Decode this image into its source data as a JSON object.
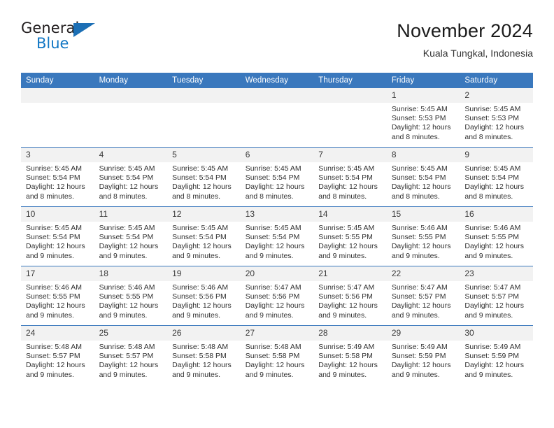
{
  "brand": {
    "name_part1": "General",
    "name_part2": "Blue",
    "logo_icon": "triangle-logo-icon"
  },
  "header": {
    "month_title": "November 2024",
    "location": "Kuala Tungkal, Indonesia"
  },
  "calendar": {
    "weekday_headers": [
      "Sunday",
      "Monday",
      "Tuesday",
      "Wednesday",
      "Thursday",
      "Friday",
      "Saturday"
    ],
    "colors": {
      "header_blue": "#3a78bd",
      "daynum_band": "#f2f2f2",
      "brand_blue": "#1277c4",
      "text": "#303030"
    },
    "weeks": [
      [
        {
          "day": "",
          "sunrise": "",
          "sunset": "",
          "daylight": "",
          "empty": true
        },
        {
          "day": "",
          "sunrise": "",
          "sunset": "",
          "daylight": "",
          "empty": true
        },
        {
          "day": "",
          "sunrise": "",
          "sunset": "",
          "daylight": "",
          "empty": true
        },
        {
          "day": "",
          "sunrise": "",
          "sunset": "",
          "daylight": "",
          "empty": true
        },
        {
          "day": "",
          "sunrise": "",
          "sunset": "",
          "daylight": "",
          "empty": true
        },
        {
          "day": "1",
          "sunrise": "Sunrise: 5:45 AM",
          "sunset": "Sunset: 5:53 PM",
          "daylight": "Daylight: 12 hours and 8 minutes.",
          "empty": false
        },
        {
          "day": "2",
          "sunrise": "Sunrise: 5:45 AM",
          "sunset": "Sunset: 5:53 PM",
          "daylight": "Daylight: 12 hours and 8 minutes.",
          "empty": false
        }
      ],
      [
        {
          "day": "3",
          "sunrise": "Sunrise: 5:45 AM",
          "sunset": "Sunset: 5:54 PM",
          "daylight": "Daylight: 12 hours and 8 minutes.",
          "empty": false
        },
        {
          "day": "4",
          "sunrise": "Sunrise: 5:45 AM",
          "sunset": "Sunset: 5:54 PM",
          "daylight": "Daylight: 12 hours and 8 minutes.",
          "empty": false
        },
        {
          "day": "5",
          "sunrise": "Sunrise: 5:45 AM",
          "sunset": "Sunset: 5:54 PM",
          "daylight": "Daylight: 12 hours and 8 minutes.",
          "empty": false
        },
        {
          "day": "6",
          "sunrise": "Sunrise: 5:45 AM",
          "sunset": "Sunset: 5:54 PM",
          "daylight": "Daylight: 12 hours and 8 minutes.",
          "empty": false
        },
        {
          "day": "7",
          "sunrise": "Sunrise: 5:45 AM",
          "sunset": "Sunset: 5:54 PM",
          "daylight": "Daylight: 12 hours and 8 minutes.",
          "empty": false
        },
        {
          "day": "8",
          "sunrise": "Sunrise: 5:45 AM",
          "sunset": "Sunset: 5:54 PM",
          "daylight": "Daylight: 12 hours and 8 minutes.",
          "empty": false
        },
        {
          "day": "9",
          "sunrise": "Sunrise: 5:45 AM",
          "sunset": "Sunset: 5:54 PM",
          "daylight": "Daylight: 12 hours and 8 minutes.",
          "empty": false
        }
      ],
      [
        {
          "day": "10",
          "sunrise": "Sunrise: 5:45 AM",
          "sunset": "Sunset: 5:54 PM",
          "daylight": "Daylight: 12 hours and 9 minutes.",
          "empty": false
        },
        {
          "day": "11",
          "sunrise": "Sunrise: 5:45 AM",
          "sunset": "Sunset: 5:54 PM",
          "daylight": "Daylight: 12 hours and 9 minutes.",
          "empty": false
        },
        {
          "day": "12",
          "sunrise": "Sunrise: 5:45 AM",
          "sunset": "Sunset: 5:54 PM",
          "daylight": "Daylight: 12 hours and 9 minutes.",
          "empty": false
        },
        {
          "day": "13",
          "sunrise": "Sunrise: 5:45 AM",
          "sunset": "Sunset: 5:54 PM",
          "daylight": "Daylight: 12 hours and 9 minutes.",
          "empty": false
        },
        {
          "day": "14",
          "sunrise": "Sunrise: 5:45 AM",
          "sunset": "Sunset: 5:55 PM",
          "daylight": "Daylight: 12 hours and 9 minutes.",
          "empty": false
        },
        {
          "day": "15",
          "sunrise": "Sunrise: 5:46 AM",
          "sunset": "Sunset: 5:55 PM",
          "daylight": "Daylight: 12 hours and 9 minutes.",
          "empty": false
        },
        {
          "day": "16",
          "sunrise": "Sunrise: 5:46 AM",
          "sunset": "Sunset: 5:55 PM",
          "daylight": "Daylight: 12 hours and 9 minutes.",
          "empty": false
        }
      ],
      [
        {
          "day": "17",
          "sunrise": "Sunrise: 5:46 AM",
          "sunset": "Sunset: 5:55 PM",
          "daylight": "Daylight: 12 hours and 9 minutes.",
          "empty": false
        },
        {
          "day": "18",
          "sunrise": "Sunrise: 5:46 AM",
          "sunset": "Sunset: 5:55 PM",
          "daylight": "Daylight: 12 hours and 9 minutes.",
          "empty": false
        },
        {
          "day": "19",
          "sunrise": "Sunrise: 5:46 AM",
          "sunset": "Sunset: 5:56 PM",
          "daylight": "Daylight: 12 hours and 9 minutes.",
          "empty": false
        },
        {
          "day": "20",
          "sunrise": "Sunrise: 5:47 AM",
          "sunset": "Sunset: 5:56 PM",
          "daylight": "Daylight: 12 hours and 9 minutes.",
          "empty": false
        },
        {
          "day": "21",
          "sunrise": "Sunrise: 5:47 AM",
          "sunset": "Sunset: 5:56 PM",
          "daylight": "Daylight: 12 hours and 9 minutes.",
          "empty": false
        },
        {
          "day": "22",
          "sunrise": "Sunrise: 5:47 AM",
          "sunset": "Sunset: 5:57 PM",
          "daylight": "Daylight: 12 hours and 9 minutes.",
          "empty": false
        },
        {
          "day": "23",
          "sunrise": "Sunrise: 5:47 AM",
          "sunset": "Sunset: 5:57 PM",
          "daylight": "Daylight: 12 hours and 9 minutes.",
          "empty": false
        }
      ],
      [
        {
          "day": "24",
          "sunrise": "Sunrise: 5:48 AM",
          "sunset": "Sunset: 5:57 PM",
          "daylight": "Daylight: 12 hours and 9 minutes.",
          "empty": false
        },
        {
          "day": "25",
          "sunrise": "Sunrise: 5:48 AM",
          "sunset": "Sunset: 5:57 PM",
          "daylight": "Daylight: 12 hours and 9 minutes.",
          "empty": false
        },
        {
          "day": "26",
          "sunrise": "Sunrise: 5:48 AM",
          "sunset": "Sunset: 5:58 PM",
          "daylight": "Daylight: 12 hours and 9 minutes.",
          "empty": false
        },
        {
          "day": "27",
          "sunrise": "Sunrise: 5:48 AM",
          "sunset": "Sunset: 5:58 PM",
          "daylight": "Daylight: 12 hours and 9 minutes.",
          "empty": false
        },
        {
          "day": "28",
          "sunrise": "Sunrise: 5:49 AM",
          "sunset": "Sunset: 5:58 PM",
          "daylight": "Daylight: 12 hours and 9 minutes.",
          "empty": false
        },
        {
          "day": "29",
          "sunrise": "Sunrise: 5:49 AM",
          "sunset": "Sunset: 5:59 PM",
          "daylight": "Daylight: 12 hours and 9 minutes.",
          "empty": false
        },
        {
          "day": "30",
          "sunrise": "Sunrise: 5:49 AM",
          "sunset": "Sunset: 5:59 PM",
          "daylight": "Daylight: 12 hours and 9 minutes.",
          "empty": false
        }
      ]
    ]
  }
}
